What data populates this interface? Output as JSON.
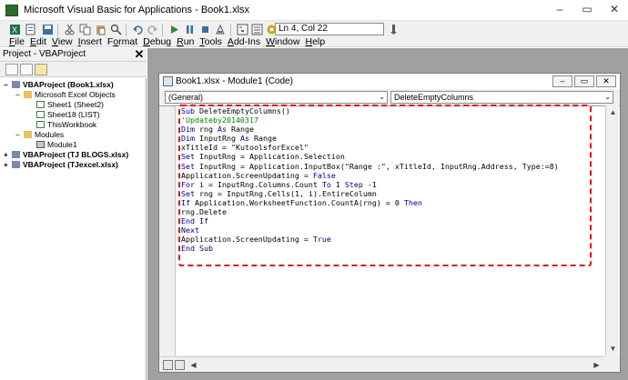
{
  "window": {
    "title": "Microsoft Visual Basic for Applications - Book1.xlsx",
    "minimize_glyph": "–",
    "maximize_glyph": "▭",
    "close_glyph": "✕"
  },
  "menu": {
    "items": [
      "File",
      "Edit",
      "View",
      "Insert",
      "Format",
      "Debug",
      "Run",
      "Tools",
      "Add-Ins",
      "Window",
      "Help"
    ],
    "underline": [
      "F",
      "E",
      "V",
      "I",
      "o",
      "D",
      "R",
      "T",
      "A",
      "W",
      "H"
    ]
  },
  "status": {
    "ln_col": "Ln 4, Col 22"
  },
  "project_explorer": {
    "title": "Project - VBAProject",
    "close_glyph": "✕",
    "tree": [
      {
        "label": "VBAProject (Book1.xlsx)",
        "bold": true,
        "toggle": "−"
      },
      {
        "label": "Microsoft Excel Objects",
        "bold": false,
        "toggle": "−"
      },
      {
        "label": "Sheet1 (Sheet2)",
        "bold": false,
        "toggle": ""
      },
      {
        "label": "Sheet18 (LIST)",
        "bold": false,
        "toggle": ""
      },
      {
        "label": "ThisWorkbook",
        "bold": false,
        "toggle": ""
      },
      {
        "label": "Modules",
        "bold": false,
        "toggle": "−"
      },
      {
        "label": "Module1",
        "bold": false,
        "toggle": ""
      },
      {
        "label": "VBAProject (TJ BLOGS.xlsx)",
        "bold": true,
        "toggle": "+"
      },
      {
        "label": "VBAProject (TJexcel.xlsx)",
        "bold": true,
        "toggle": "+"
      }
    ]
  },
  "code_window": {
    "title": "Book1.xlsx - Module1 (Code)",
    "object_combo": "(General)",
    "proc_combo": "DeleteEmptyColumns",
    "lines": [
      "Sub DeleteEmptyColumns()",
      "'Updateby20140317",
      "Dim rng As Range",
      "Dim InputRng As Range",
      "xTitleId = \"KutoolsforExcel\"",
      "Set InputRng = Application.Selection",
      "Set InputRng = Application.InputBox(\"Range :\", xTitleId, InputRng.Address, Type:=8)",
      "Application.ScreenUpdating = False",
      "For i = InputRng.Columns.Count To 1 Step -1",
      "Set rng = InputRng.Cells(1, i).EntireColumn",
      "If Application.WorksheetFunction.CountA(rng) = 0 Then",
      "rng.Delete",
      "End If",
      "Next",
      "Application.ScreenUpdating = True",
      "End Sub"
    ]
  },
  "colors": {
    "highlight": "#e01010",
    "keyword": "#00008b",
    "comment": "#008000",
    "mdi_background": "#a0a0a0"
  },
  "icons": {
    "toolbar": [
      "excel-icon",
      "insert-module-icon",
      "save-icon",
      "cut-icon",
      "copy-icon",
      "paste-icon",
      "find-icon",
      "undo-icon",
      "redo-icon",
      "run-icon",
      "break-icon",
      "reset-icon",
      "design-mode-icon",
      "project-explorer-icon",
      "properties-icon",
      "object-browser-icon",
      "toolbox-icon",
      "help-icon"
    ]
  }
}
